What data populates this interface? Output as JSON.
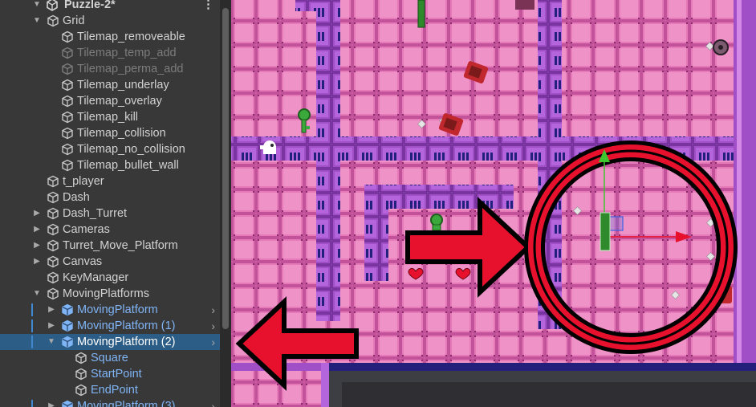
{
  "hierarchy": {
    "scene_title": "Puzzle-2*",
    "menu_icon": "kebab-menu-icon",
    "items": [
      {
        "label": "Grid",
        "indent": 1,
        "fold": "open",
        "style": "normal",
        "icon": "gameobject-icon"
      },
      {
        "label": "Tilemap_removeable",
        "indent": 2,
        "fold": "none",
        "style": "normal",
        "icon": "gameobject-icon"
      },
      {
        "label": "Tilemap_temp_add",
        "indent": 2,
        "fold": "none",
        "style": "dim",
        "icon": "gameobject-icon"
      },
      {
        "label": "Tilemap_perma_add",
        "indent": 2,
        "fold": "none",
        "style": "dim",
        "icon": "gameobject-icon"
      },
      {
        "label": "Tilemap_underlay",
        "indent": 2,
        "fold": "none",
        "style": "normal",
        "icon": "gameobject-icon"
      },
      {
        "label": "Tilemap_overlay",
        "indent": 2,
        "fold": "none",
        "style": "normal",
        "icon": "gameobject-icon"
      },
      {
        "label": "Tilemap_kill",
        "indent": 2,
        "fold": "none",
        "style": "normal",
        "icon": "gameobject-icon"
      },
      {
        "label": "Tilemap_collision",
        "indent": 2,
        "fold": "none",
        "style": "normal",
        "icon": "gameobject-icon"
      },
      {
        "label": "Tilemap_no_collision",
        "indent": 2,
        "fold": "none",
        "style": "normal",
        "icon": "gameobject-icon"
      },
      {
        "label": "Tilemap_bullet_wall",
        "indent": 2,
        "fold": "none",
        "style": "normal",
        "icon": "gameobject-icon"
      },
      {
        "label": "t_player",
        "indent": 1,
        "fold": "none",
        "style": "normal",
        "icon": "gameobject-icon"
      },
      {
        "label": "Dash",
        "indent": 1,
        "fold": "none",
        "style": "normal",
        "icon": "gameobject-icon"
      },
      {
        "label": "Dash_Turret",
        "indent": 1,
        "fold": "closed",
        "style": "normal",
        "icon": "gameobject-icon"
      },
      {
        "label": "Cameras",
        "indent": 1,
        "fold": "closed",
        "style": "normal",
        "icon": "gameobject-icon"
      },
      {
        "label": "Turret_Move_Platform",
        "indent": 1,
        "fold": "closed",
        "style": "normal",
        "icon": "gameobject-icon"
      },
      {
        "label": "Canvas",
        "indent": 1,
        "fold": "closed",
        "style": "normal",
        "icon": "gameobject-icon"
      },
      {
        "label": "KeyManager",
        "indent": 1,
        "fold": "none",
        "style": "normal",
        "icon": "gameobject-icon"
      },
      {
        "label": "MovingPlatforms",
        "indent": 1,
        "fold": "open",
        "style": "normal",
        "icon": "gameobject-icon"
      },
      {
        "label": "MovingPlatform",
        "indent": 2,
        "fold": "closed",
        "style": "prefab",
        "icon": "prefab-icon",
        "chevron": true,
        "marker": true
      },
      {
        "label": "MovingPlatform (1)",
        "indent": 2,
        "fold": "closed",
        "style": "prefab",
        "icon": "prefab-icon",
        "chevron": true,
        "marker": true
      },
      {
        "label": "MovingPlatform (2)",
        "indent": 2,
        "fold": "open",
        "style": "selected",
        "icon": "prefab-icon",
        "chevron": true,
        "marker": true
      },
      {
        "label": "Square",
        "indent": 3,
        "fold": "none",
        "style": "prefab",
        "icon": "gameobject-icon"
      },
      {
        "label": "StartPoint",
        "indent": 3,
        "fold": "none",
        "style": "prefab",
        "icon": "gameobject-icon"
      },
      {
        "label": "EndPoint",
        "indent": 3,
        "fold": "none",
        "style": "prefab",
        "icon": "gameobject-icon"
      },
      {
        "label": "MovingPlatform (3)",
        "indent": 2,
        "fold": "closed",
        "style": "prefab",
        "icon": "prefab-icon",
        "chevron": true,
        "marker": true
      }
    ]
  },
  "scene_view": {
    "floor_color": "#e67ab8",
    "wall_color": "#a04fc7",
    "selection_ring_color": "#e8112d",
    "gizmo_x_color": "#e8112d",
    "gizmo_y_color": "#3ec62f",
    "void_color": "#3a3a3a",
    "border_color": "#22207a",
    "icons": [
      "key-icon",
      "heart-icon",
      "turret-icon",
      "player-ghost-icon",
      "move-gizmo-icon",
      "arrow-right-icon",
      "arrow-left-icon"
    ]
  }
}
